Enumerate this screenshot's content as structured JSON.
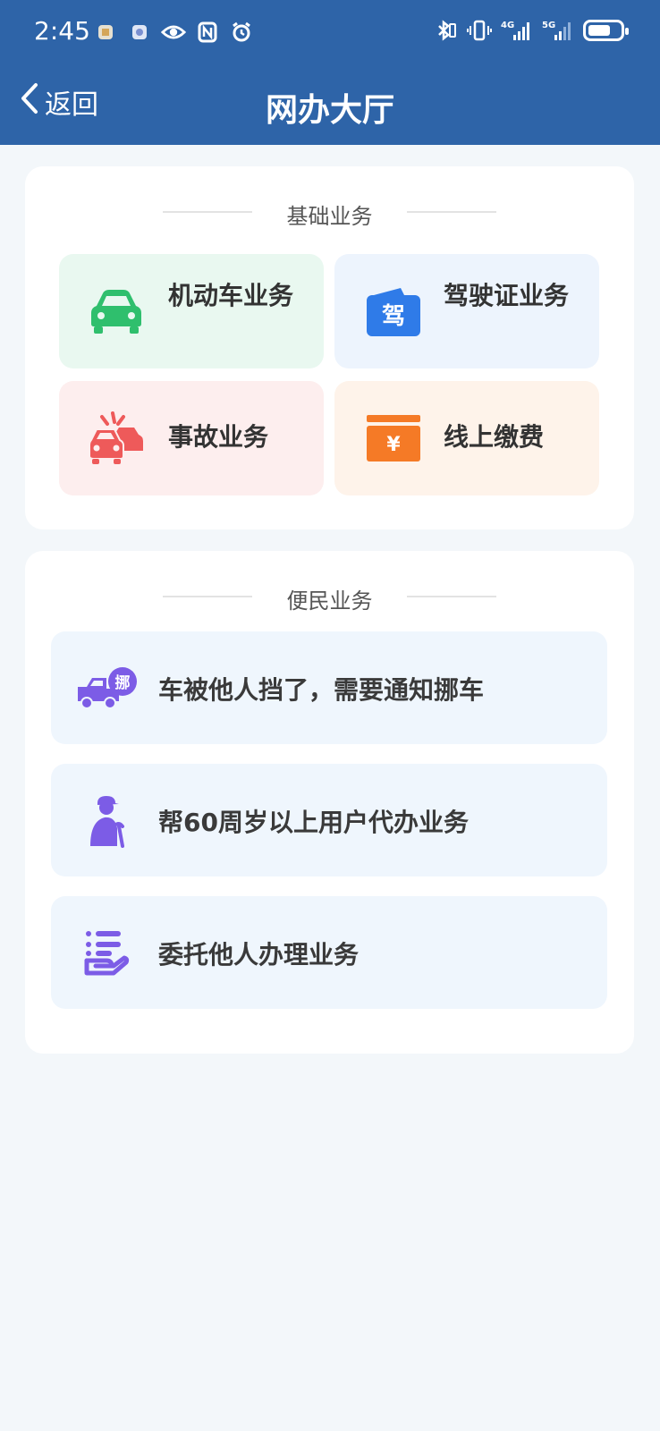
{
  "status_bar": {
    "time": "2:45",
    "battery_level": 0.7,
    "network_labels": [
      "4G",
      "5G"
    ]
  },
  "nav": {
    "back_label": "返回",
    "title": "网办大厅"
  },
  "basic_section": {
    "title": "基础业务",
    "tiles": [
      {
        "label": "机动车业务",
        "icon": "car-icon",
        "bg": "#e9f8f0",
        "icon_color": "#2fbf6d"
      },
      {
        "label": "驾驶证业务",
        "icon": "license-icon",
        "bg": "#edf4fd",
        "icon_color": "#2f7be8",
        "icon_text": "驾"
      },
      {
        "label": "事故业务",
        "icon": "accident-icon",
        "bg": "#fdeeee",
        "icon_color": "#ee5a5a"
      },
      {
        "label": "线上缴费",
        "icon": "payment-icon",
        "bg": "#fef3ea",
        "icon_color": "#f57a26",
        "icon_text": "¥"
      }
    ]
  },
  "convenience_section": {
    "title": "便民业务",
    "rows": [
      {
        "label": "车被他人挡了，需要通知挪车",
        "icon": "tow-truck-icon",
        "icon_text": "挪"
      },
      {
        "label": "帮60周岁以上用户代办业务",
        "icon": "elderly-person-icon"
      },
      {
        "label": "委托他人办理业务",
        "icon": "hand-list-icon"
      }
    ],
    "icon_color": "#7c5ce6"
  }
}
